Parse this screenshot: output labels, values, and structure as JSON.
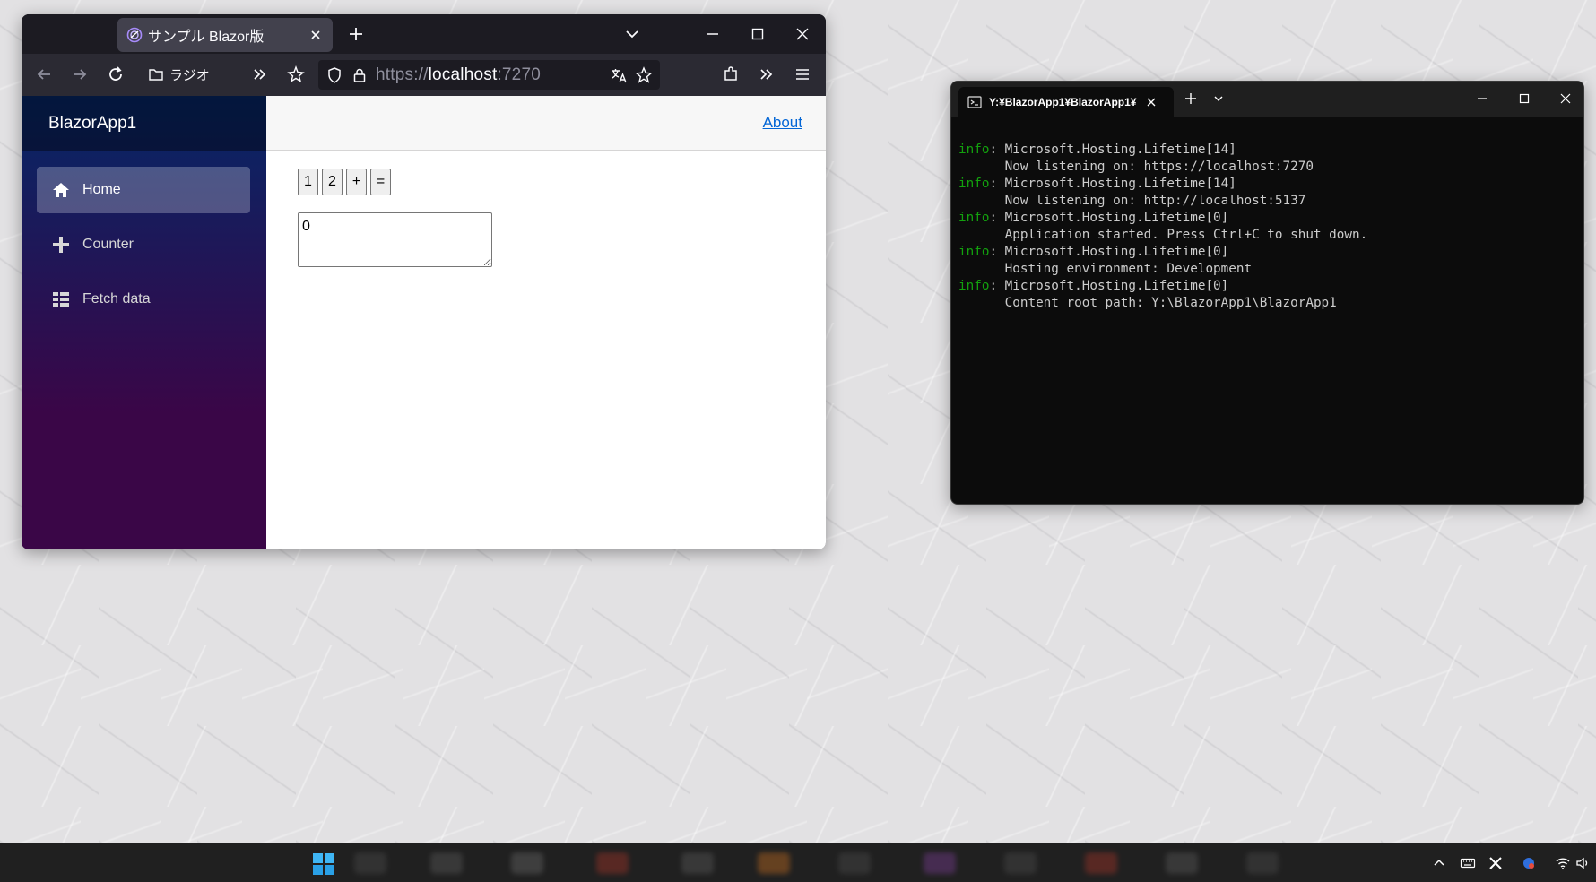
{
  "browser": {
    "tab_title": "サンプル Blazor版",
    "bookmark_label": "ラジオ",
    "url_scheme": "https://",
    "url_host": "localhost",
    "url_port": ":7270",
    "app": {
      "brand": "BlazorApp1",
      "nav_items": [
        {
          "label": "Home",
          "icon": "home-icon",
          "active": true
        },
        {
          "label": "Counter",
          "icon": "plus-icon",
          "active": false
        },
        {
          "label": "Fetch data",
          "icon": "list-icon",
          "active": false
        }
      ],
      "about_label": "About",
      "calc_buttons": [
        "1",
        "2",
        "+",
        "="
      ],
      "output_value": "0"
    }
  },
  "terminal": {
    "tab_title": "Y:¥BlazorApp1¥BlazorApp1¥",
    "lines": [
      {
        "level": "info",
        "text": ": Microsoft.Hosting.Lifetime[14]"
      },
      {
        "level": "",
        "text": "      Now listening on: https://localhost:7270"
      },
      {
        "level": "info",
        "text": ": Microsoft.Hosting.Lifetime[14]"
      },
      {
        "level": "",
        "text": "      Now listening on: http://localhost:5137"
      },
      {
        "level": "info",
        "text": ": Microsoft.Hosting.Lifetime[0]"
      },
      {
        "level": "",
        "text": "      Application started. Press Ctrl+C to shut down."
      },
      {
        "level": "info",
        "text": ": Microsoft.Hosting.Lifetime[0]"
      },
      {
        "level": "",
        "text": "      Hosting environment: Development"
      },
      {
        "level": "info",
        "text": ": Microsoft.Hosting.Lifetime[0]"
      },
      {
        "level": "",
        "text": "      Content root path: Y:\\BlazorApp1\\BlazorApp1"
      }
    ]
  },
  "colors": {
    "terminal_info": "#13a10e",
    "link": "#0366d6",
    "sidebar_top": "#052767",
    "sidebar_bottom": "#3a0647"
  }
}
